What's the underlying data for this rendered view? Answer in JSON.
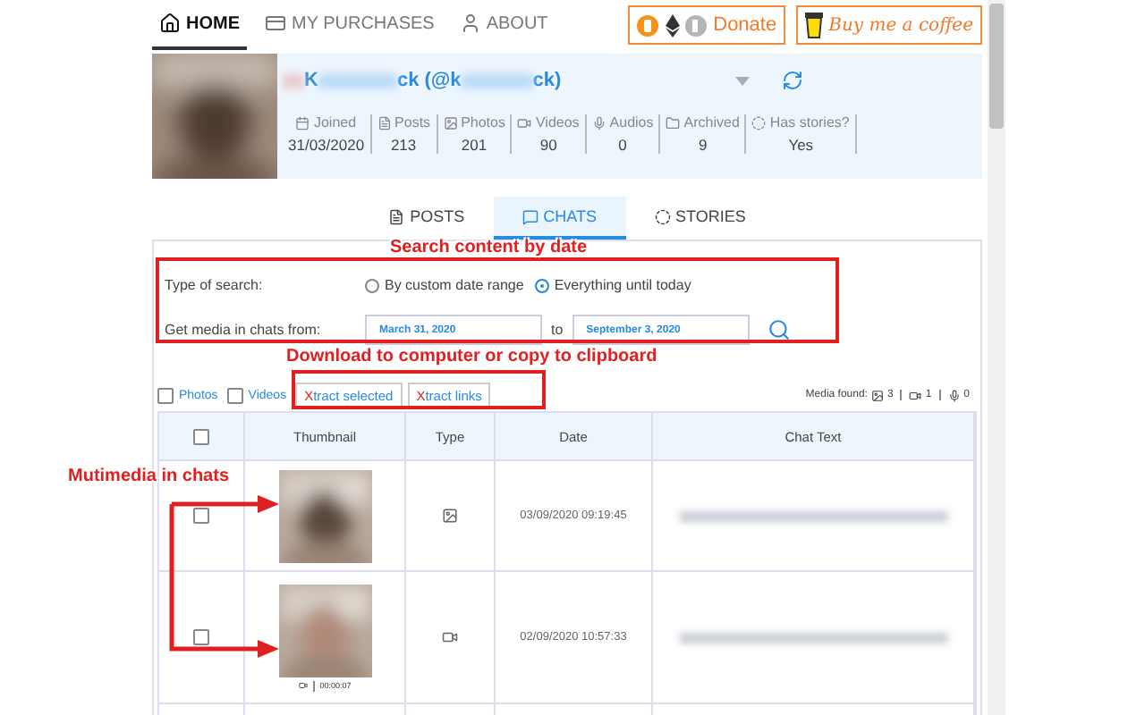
{
  "nav": {
    "items": [
      {
        "label": "HOME",
        "kind": "home",
        "selected": true
      },
      {
        "label": "MY PURCHASES",
        "kind": "card",
        "selected": false
      },
      {
        "label": "ABOUT",
        "kind": "user",
        "selected": false
      }
    ],
    "donate": "Donate",
    "coffee": "Buy me a coffee"
  },
  "profile": {
    "name_parts": [
      "K",
      "ck (@k",
      "ck)"
    ],
    "stats": [
      {
        "kind": "calendar",
        "label": "Joined",
        "value": "31/03/2020"
      },
      {
        "kind": "posts",
        "label": "Posts",
        "value": "213"
      },
      {
        "label": "Photos",
        "value": "201"
      },
      {
        "kind": "video",
        "label": "Videos",
        "value": "90"
      },
      {
        "kind": "audio",
        "label": "Audios",
        "value": "0"
      },
      {
        "kind": "folder",
        "label": "Archived",
        "value": "9"
      },
      {
        "kind": "stories",
        "label": "Has stories?",
        "value": "Yes"
      }
    ]
  },
  "tabs": [
    {
      "label": "POSTS",
      "kind": "posts",
      "selected": false
    },
    {
      "label": "CHATS",
      "kind": "chat",
      "selected": true
    },
    {
      "label": "STORIES",
      "kind": "stories",
      "selected": false
    }
  ],
  "search": {
    "type_label": "Type of search:",
    "options": [
      {
        "label": "By custom date range",
        "selected": false
      },
      {
        "label": "Everything until today",
        "selected": true
      }
    ],
    "range_label": "Get media in chats from:",
    "from": "March 31, 2020",
    "to_label": "to",
    "to": "September 3, 2020"
  },
  "filters": [
    {
      "label": "Photos",
      "checked": false
    },
    {
      "label": "Videos",
      "checked": false
    }
  ],
  "actions": [
    {
      "first": "X",
      "rest": "tract selected"
    },
    {
      "first": "X",
      "rest": "tract links"
    }
  ],
  "media_found": {
    "label": "Media found:",
    "counts": [
      {
        "count": "3"
      },
      {
        "kind": "video",
        "count": "1"
      },
      {
        "kind": "audio",
        "count": "0"
      }
    ]
  },
  "table": {
    "header_checked": false,
    "columns": [
      "Thumbnail",
      "Type",
      "Date",
      "Chat Text"
    ],
    "rows": [
      {
        "checked": false,
        "date": "03/09/2020 09:19:45"
      },
      {
        "checked": false,
        "kind": "video",
        "date": "02/09/2020 10:57:33",
        "duration": "00:00:07"
      }
    ]
  },
  "annotations": [
    {
      "kind": "box",
      "text": "Search content by date"
    },
    {
      "kind": "box",
      "text": "Download to computer or copy to clipboard"
    },
    {
      "kind": "arrows",
      "text": "Mutimedia in chats"
    }
  ]
}
